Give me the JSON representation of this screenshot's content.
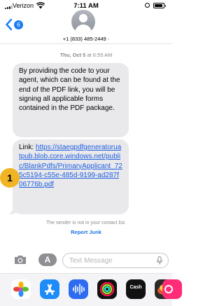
{
  "status_bar": {
    "carrier": "Verizon",
    "time": "7:11 AM"
  },
  "header": {
    "back_badge": "6",
    "contact": "+1 (833) 485-2449",
    "contact_chevron": "›"
  },
  "thread": {
    "date_day": "Thu, Oct 5",
    "date_time": "at 6:55 AM",
    "messages": [
      "By providing the code to your agent, which can be found at the end of the PDF link, you will be signing all applicable forms contained in the PDF package."
    ],
    "link_prefix": "Link: ",
    "link_text": "https://staegpdfgeneratoruatpub.blob.core.windows.net/public/BlankPdfs/PrimaryApplicant_725c5194-c55e-485d-9199-ad287f06776b.pdf",
    "annotation_marker": "1",
    "notice": "The sender is not in your contact list.",
    "report_junk": "Report Junk"
  },
  "compose": {
    "apps_button": "A",
    "placeholder": "Text Message"
  },
  "app_drawer": {
    "apps": [
      {
        "icon": "photos-icon"
      },
      {
        "icon": "app-store-icon"
      },
      {
        "icon": "audio-icon"
      },
      {
        "icon": "fitness-icon"
      },
      {
        "icon": "cash-app-icon",
        "label": "Cash"
      },
      {
        "icon": "game-icon"
      },
      {
        "icon": "pink-app-icon"
      }
    ]
  }
}
